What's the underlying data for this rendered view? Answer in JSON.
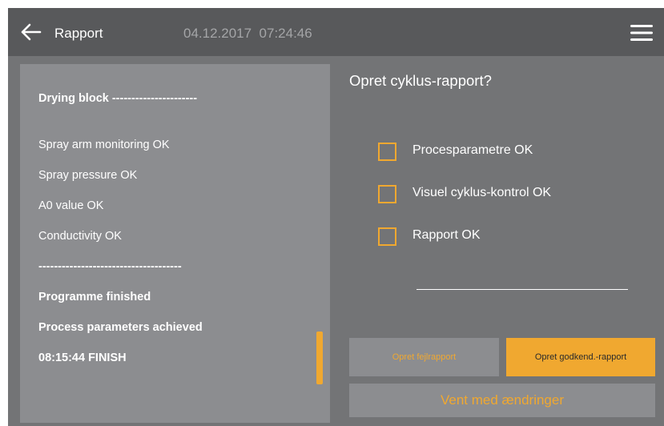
{
  "header": {
    "title": "Rapport",
    "datetime": "04.12.2017  07:24:46",
    "back_icon": "back-arrow-icon",
    "menu_icon": "hamburger-menu-icon"
  },
  "log": {
    "lines": [
      {
        "text": "Drying block ----------------------",
        "bold": true
      },
      {
        "text": "Spray arm monitoring OK",
        "bold": false
      },
      {
        "text": "Spray pressure OK",
        "bold": false
      },
      {
        "text": "A0 value OK",
        "bold": false
      },
      {
        "text": "Conductivity OK",
        "bold": false
      },
      {
        "text": "-------------------------------------",
        "bold": true
      },
      {
        "text": "Programme finished",
        "bold": true
      },
      {
        "text": "Process parameters achieved",
        "bold": true
      },
      {
        "text": "08:15:44 FINISH",
        "bold": true
      }
    ]
  },
  "report": {
    "question": "Opret cyklus-rapport?",
    "checks": [
      {
        "label": "Procesparametre OK",
        "checked": false
      },
      {
        "label": "Visuel cyklus-kontrol OK",
        "checked": false
      },
      {
        "label": "Rapport OK",
        "checked": false
      }
    ],
    "error_report_label": "Opret fejlrapport",
    "approve_report_label": "Opret godkend.-rapport",
    "wait_label": "Vent med ændringer"
  },
  "colors": {
    "accent": "#f0a830",
    "background": "#737476",
    "header": "#58595b",
    "panel": "#8c8d90"
  }
}
